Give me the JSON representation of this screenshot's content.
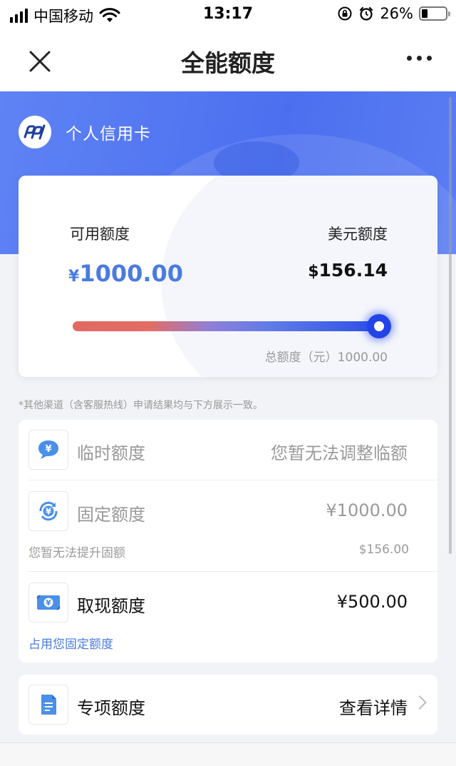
{
  "status_bar": {
    "carrier": "中国移动",
    "time": "13:17",
    "battery": "26%",
    "battery_level": 0.26
  },
  "nav": {
    "title": "全能额度",
    "close_icon": "close-icon",
    "more_icon": "more-icon"
  },
  "header": {
    "card_type": "个人信用卡",
    "logo_icon": "bank-logo-icon"
  },
  "credit_card": {
    "available_label": "可用额度",
    "available_currency": "¥",
    "available_amount": "1000.00",
    "usd_label": "美元额度",
    "usd_currency": "$",
    "usd_amount": "156.14",
    "usage_fraction": 1.0,
    "total_line": "总额度（元）1000.00"
  },
  "note": "*其他渠道（含客服热线）申请结果均与下方展示一致。",
  "limits": {
    "temporary": {
      "title": "临时额度",
      "value": "您暂无法调整临额",
      "icon": "temporary-limit-icon"
    },
    "fixed": {
      "title": "固定额度",
      "value": "¥1000.00",
      "sub_left": "您暂无法提升固额",
      "sub_right": "$156.00",
      "icon": "fixed-limit-icon"
    },
    "cash": {
      "title": "取现额度",
      "value": "¥500.00",
      "sub_left": "占用您固定额度",
      "icon": "cash-limit-icon"
    },
    "special": {
      "title": "专项额度",
      "value": "查看详情",
      "icon": "special-limit-icon"
    }
  },
  "colors": {
    "accent_blue": "#4a7bdf",
    "header_blue": "#4c6ff0",
    "muted_text": "#9a9a9a",
    "slider_start": "#e06a63",
    "slider_end": "#2d4fe6"
  }
}
